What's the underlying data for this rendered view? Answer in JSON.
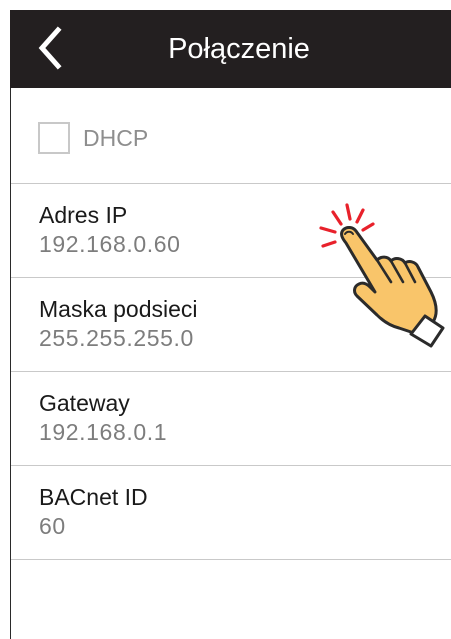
{
  "header": {
    "title": "Połączenie",
    "back_icon": "chevron-left-icon"
  },
  "dhcp": {
    "label": "DHCP",
    "checked": false
  },
  "fields": [
    {
      "label": "Adres IP",
      "value": "192.168.0.60"
    },
    {
      "label": "Maska podsieci",
      "value": "255.255.255.0"
    },
    {
      "label": "Gateway",
      "value": "192.168.0.1"
    },
    {
      "label": "BACnet ID",
      "value": "60"
    }
  ],
  "overlay": {
    "icon": "tap-hand-icon",
    "colors": {
      "hand_fill": "#f9c56a",
      "hand_outline": "#2b2b2b",
      "tap_rays": "#e8212b"
    }
  },
  "colors": {
    "header_bg": "#231f20",
    "header_text": "#ffffff",
    "label_text": "#1a1a1a",
    "value_text": "#7d7d7d",
    "divider": "#c9c9c9"
  }
}
